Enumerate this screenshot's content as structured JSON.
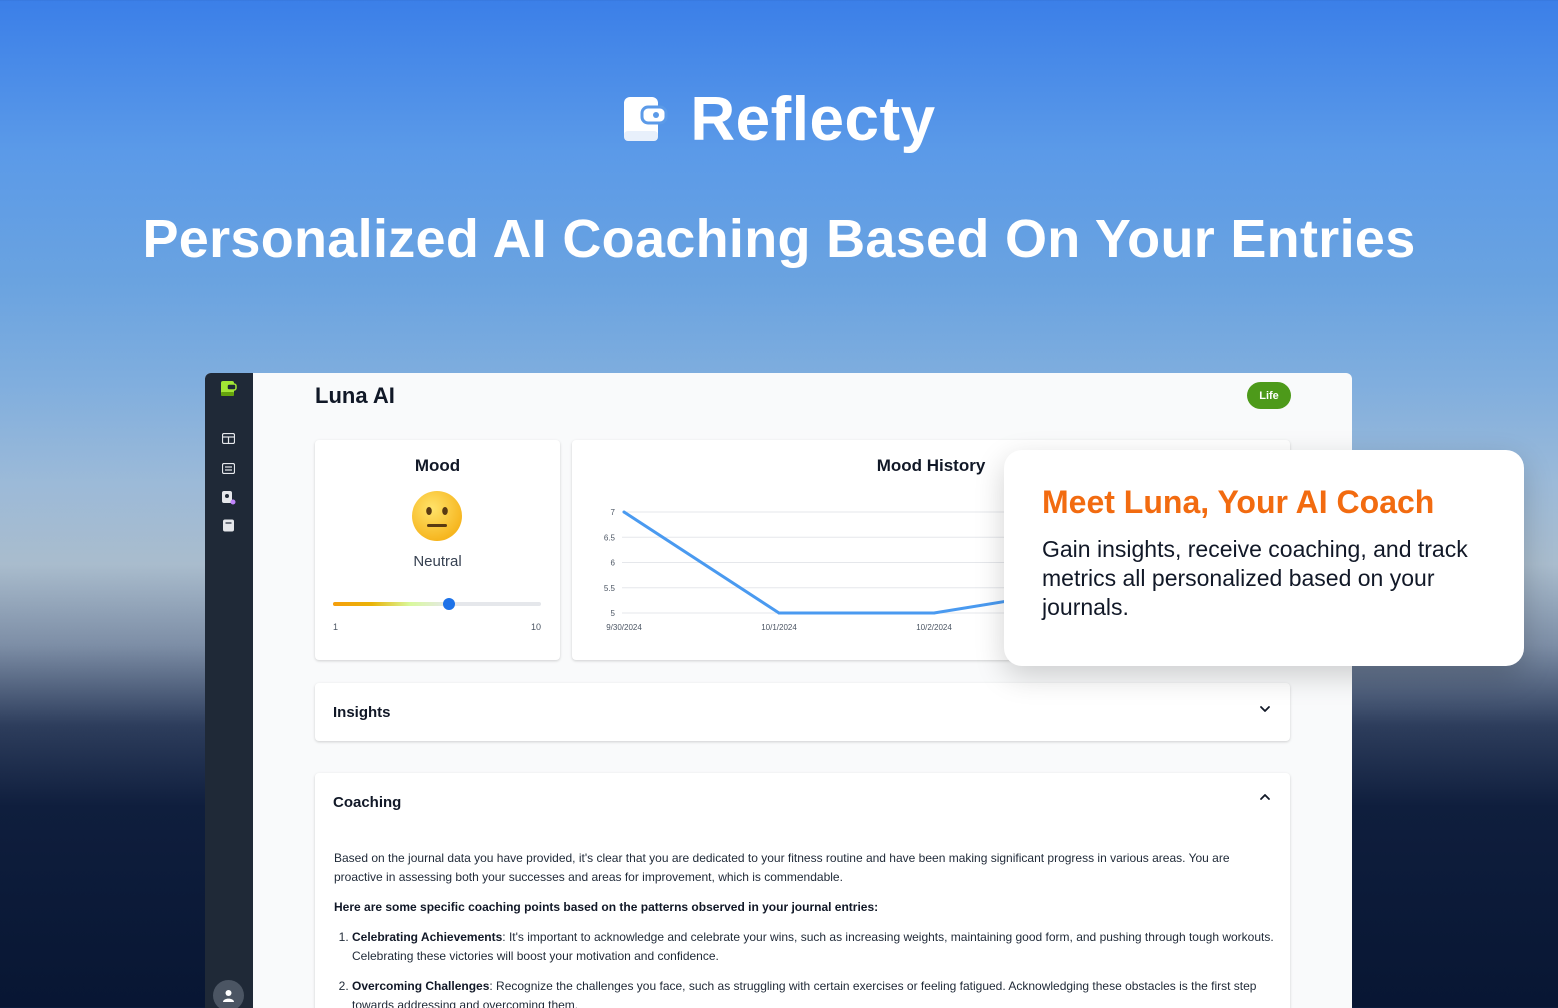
{
  "brand": {
    "name": "Reflecty",
    "logo_icon": "journal-book-icon"
  },
  "headline": "Personalized AI Coaching Based On Your Entries",
  "app": {
    "sidebar": {
      "items": [
        {
          "icon": "app-logo-icon"
        },
        {
          "icon": "dashboard-icon"
        },
        {
          "icon": "list-icon"
        },
        {
          "icon": "ai-coach-icon"
        },
        {
          "icon": "journal-icon"
        }
      ],
      "avatar_icon": "user-icon"
    },
    "page_title": "Luna AI",
    "badge": "Life",
    "mood": {
      "title": "Mood",
      "emoji": "neutral-face-icon",
      "label": "Neutral",
      "slider_min": "1",
      "slider_max": "10",
      "slider_value": 6
    },
    "mood_history": {
      "title": "Mood History"
    },
    "insights": {
      "title": "Insights"
    },
    "coaching": {
      "title": "Coaching",
      "intro": "Based on the journal data you have provided, it's clear that you are dedicated to your fitness routine and have been making significant progress in various areas. You are proactive in assessing both your successes and areas for improvement, which is commendable.",
      "lead": "Here are some specific coaching points based on the patterns observed in your journal entries:",
      "points": [
        {
          "title": "Celebrating Achievements",
          "text": ": It's important to acknowledge and celebrate your wins, such as increasing weights, maintaining good form, and pushing through tough workouts. Celebrating these victories will boost your motivation and confidence."
        },
        {
          "title": "Overcoming Challenges",
          "text": ": Recognize the challenges you face, such as struggling with certain exercises or feeling fatigued. Acknowledging these obstacles is the first step towards addressing and overcoming them."
        }
      ]
    }
  },
  "overlay": {
    "title": "Meet Luna, Your AI Coach",
    "text": "Gain insights, receive coaching, and track metrics all personalized based on your journals."
  },
  "colors": {
    "accent": "#f26b10",
    "line": "#4a9af0",
    "badge": "#4d9a1a",
    "sidebar": "#1f2937"
  },
  "chart_data": {
    "type": "line",
    "title": "Mood History",
    "x": [
      "9/30/2024",
      "10/1/2024",
      "10/2/2024"
    ],
    "series": [
      {
        "values": [
          7,
          5,
          5,
          5.5
        ]
      }
    ],
    "yticks": [
      "5",
      "5.5",
      "6",
      "6.5",
      "7"
    ],
    "ylim": [
      5,
      7
    ],
    "grid": true
  }
}
